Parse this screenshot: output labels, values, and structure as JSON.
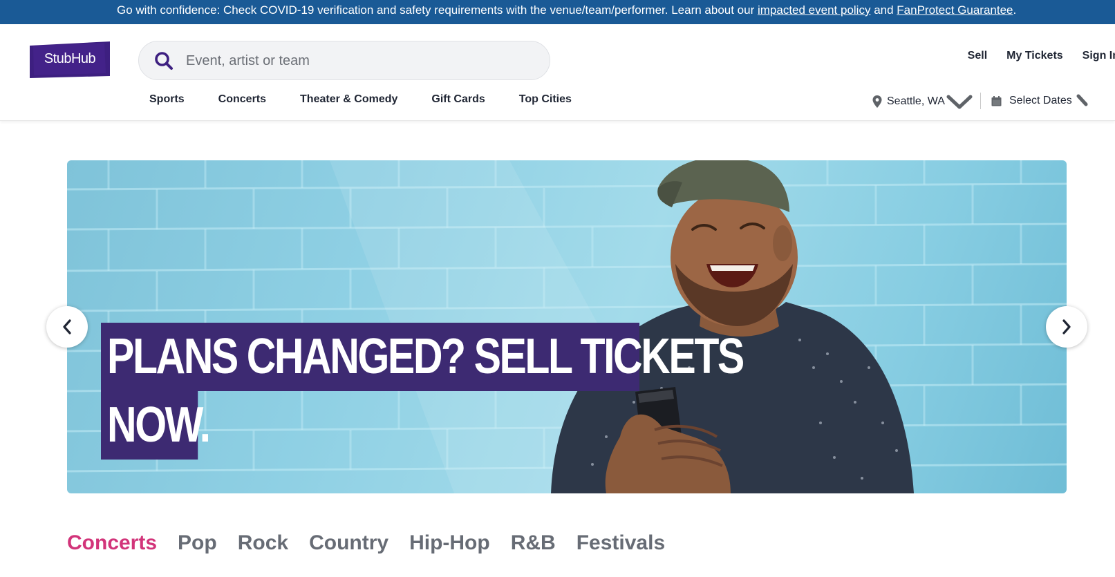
{
  "banner": {
    "text_before": "Go with confidence: Check COVID-19 verification and safety requirements with the venue/team/performer. Learn about our ",
    "link_policy": "impacted event policy",
    "text_and": " and ",
    "link_guarantee": "FanProtect Guarantee",
    "text_end": "."
  },
  "brand": {
    "logo_text": "StubHub",
    "color": "#3d1f80"
  },
  "search": {
    "placeholder": "Event, artist or team",
    "value": "",
    "icon": "search-icon"
  },
  "account_links": {
    "sell": "Sell",
    "my_tickets": "My Tickets",
    "sign_in": "Sign In"
  },
  "nav": {
    "items": [
      {
        "label": "Sports"
      },
      {
        "label": "Concerts"
      },
      {
        "label": "Theater & Comedy"
      },
      {
        "label": "Gift Cards"
      },
      {
        "label": "Top Cities"
      }
    ]
  },
  "filters": {
    "location": "Seattle, WA",
    "dates": "Select Dates"
  },
  "hero": {
    "headline_line1": "PLANS CHANGED? SELL TICKETS",
    "headline_line2": "NOW.",
    "headline_bg": "#3d2a72"
  },
  "categories": {
    "active_color": "#d2347a",
    "items": [
      {
        "label": "Concerts",
        "active": true
      },
      {
        "label": "Pop",
        "active": false
      },
      {
        "label": "Rock",
        "active": false
      },
      {
        "label": "Country",
        "active": false
      },
      {
        "label": "Hip-Hop",
        "active": false
      },
      {
        "label": "R&B",
        "active": false
      },
      {
        "label": "Festivals",
        "active": false
      }
    ]
  }
}
